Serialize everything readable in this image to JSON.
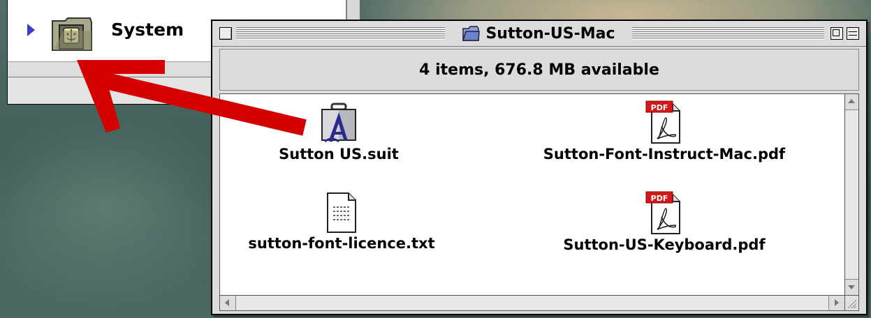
{
  "back_window": {
    "row_label": "System"
  },
  "window": {
    "title": "Sutton-US-Mac",
    "status": "4 items, 676.8 MB available"
  },
  "files": [
    {
      "name": "Sutton US.suit",
      "icon": "font-suitcase-icon"
    },
    {
      "name": "Sutton-Font-Instruct-Mac.pdf",
      "icon": "pdf-document-icon"
    },
    {
      "name": "sutton-font-licence.txt",
      "icon": "text-document-icon"
    },
    {
      "name": "Sutton-US-Keyboard.pdf",
      "icon": "pdf-document-icon"
    }
  ],
  "pdf_badge": "PDF",
  "colors": {
    "arrow": "#d40000",
    "pdf_badge": "#d21a1a",
    "folder_blue": "#7c8ed6"
  }
}
